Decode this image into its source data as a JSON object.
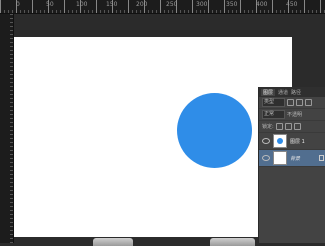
{
  "ruler": {
    "top_numbers": [
      "0",
      "50",
      "100",
      "150",
      "200",
      "250",
      "300",
      "350",
      "400",
      "450"
    ]
  },
  "layers_panel": {
    "tabs": [
      "图层",
      "通道",
      "路径"
    ],
    "filter_label": "类型",
    "blend_mode": "正常",
    "opacity_label": "不透明",
    "lock_label": "锁定:",
    "layers": [
      {
        "name": "图层 1",
        "has_circle_thumb": true,
        "selected": false
      },
      {
        "name": "背景",
        "has_circle_thumb": false,
        "selected": true
      }
    ]
  },
  "colors": {
    "circle_fill": "#2f8de8",
    "canvas_bg": "#ffffff",
    "workspace_bg": "#2b2b2b",
    "selection": "#516e8f"
  }
}
